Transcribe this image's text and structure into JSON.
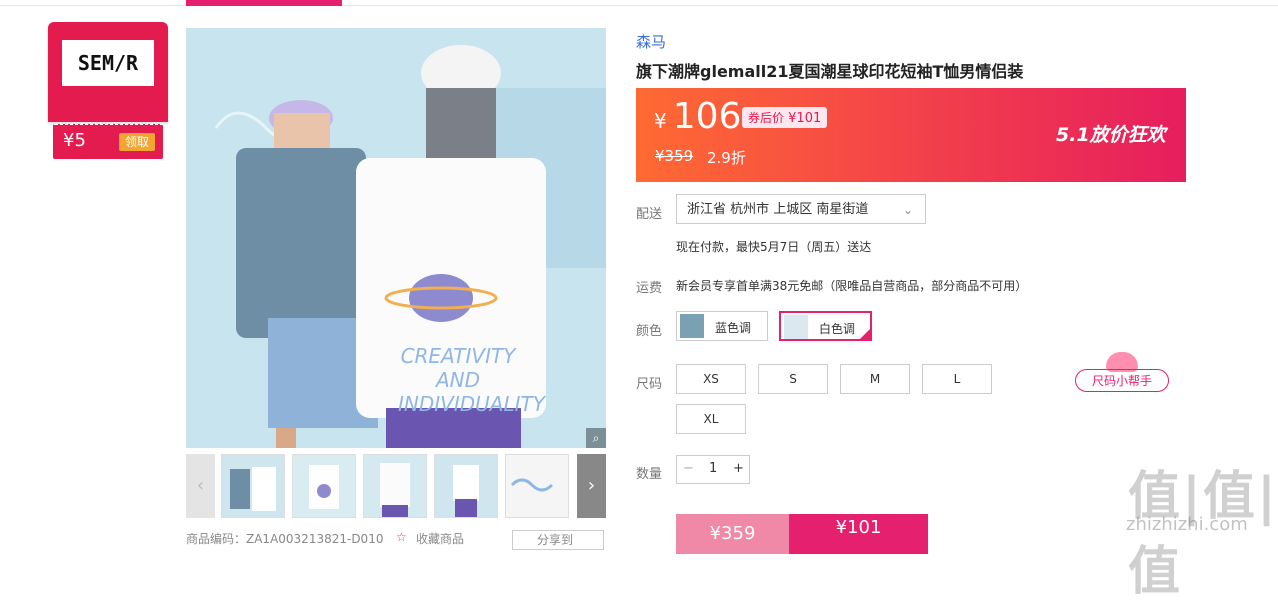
{
  "store": {
    "logo": "SEM/R",
    "coupon_amount": "¥5",
    "coupon_button": "领取"
  },
  "product": {
    "brand": "森马",
    "title": "旗下潮牌glemall21夏国潮星球印花短袖T恤男情侣装",
    "image_text": [
      "CREATIVITY",
      "AND",
      "INDIVIDUALITY"
    ]
  },
  "price": {
    "symbol": "¥",
    "current": "106",
    "after_coupon_label": "券后价",
    "after_coupon_value": "¥101",
    "original": "¥359",
    "discount": "2.9折",
    "promo": "5.1放价狂欢"
  },
  "delivery": {
    "label": "配送",
    "address": "浙江省 杭州市 上城区 南星街道",
    "eta": "现在付款，最快5月7日（周五）送达"
  },
  "shipping": {
    "label": "运费",
    "text": "新会员专享首单满38元免邮（限唯品自营商品，部分商品不可用）"
  },
  "color": {
    "label": "颜色",
    "options": [
      "蓝色调",
      "白色调"
    ],
    "selected": "白色调"
  },
  "size": {
    "label": "尺码",
    "options": [
      "XS",
      "S",
      "M",
      "L",
      "XL"
    ],
    "helper": "尺码小帮手"
  },
  "quantity": {
    "label": "数量",
    "minus": "−",
    "value": "1",
    "plus": "+"
  },
  "buy": {
    "left": "¥359",
    "right": "¥101"
  },
  "bottom": {
    "code_label": "商品编码：ZA1A003213821-D010",
    "favorite": "收藏商品",
    "share": "分享到"
  },
  "watermark": {
    "big": "值|值|值",
    "small": "zhizhizhi.com"
  },
  "colors": {
    "accent": "#e5206e",
    "price_grad_start": "#ff6a33",
    "price_grad_end": "#e61e5e",
    "brand_link": "#3a6fd6"
  }
}
